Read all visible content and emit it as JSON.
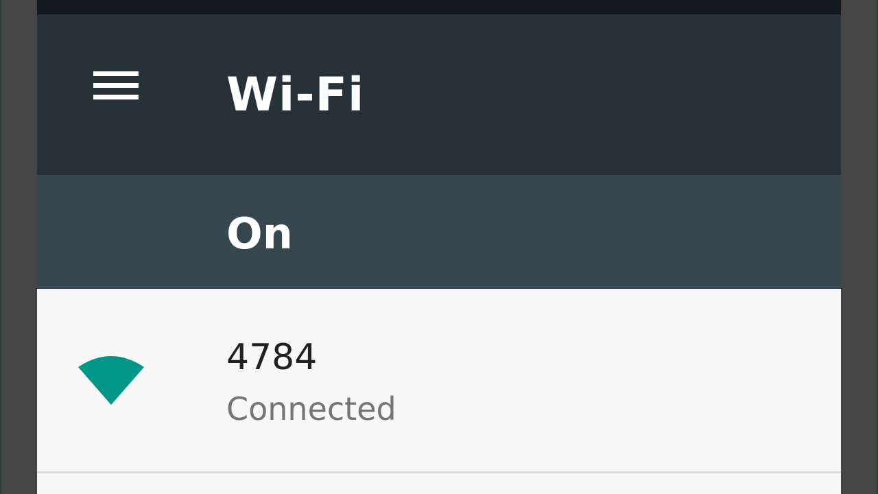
{
  "app_bar": {
    "title": "Wi-Fi",
    "menu_icon": "hamburger-menu-icon",
    "background_color": "#263238"
  },
  "master_switch": {
    "label": "On",
    "background_color": "#37474f"
  },
  "networks": [
    {
      "name": "4784",
      "status": "Connected",
      "icon": "wifi-signal-icon",
      "icon_color": "#009688"
    }
  ]
}
